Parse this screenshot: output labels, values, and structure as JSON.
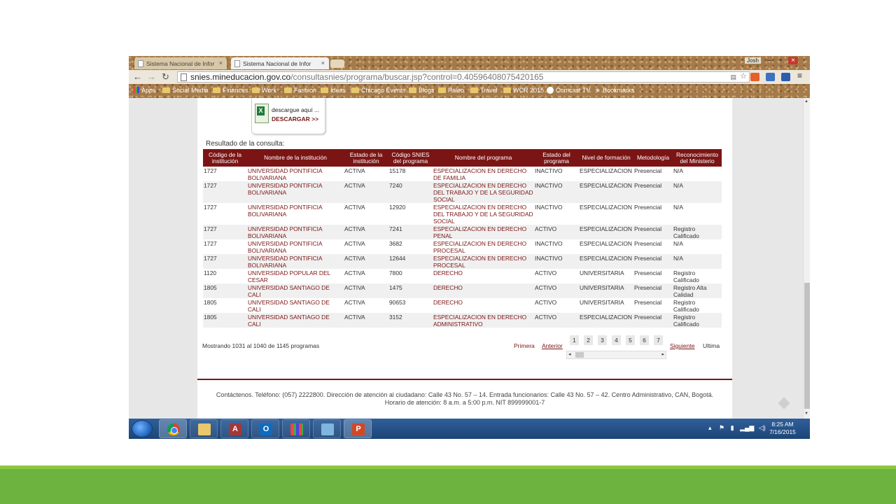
{
  "browser": {
    "tabs": [
      {
        "label": "Sistema Nacional de Infor"
      },
      {
        "label": "Sistema Nacional de Infor"
      }
    ],
    "user": "Josh",
    "url_host": "snies.mineducacion.gov.co",
    "url_path": "/consultasnies/programa/buscar.jsp?control=0.40596408075420165",
    "bookmarks": [
      "Apps",
      "Social Media",
      "Finances",
      "Work",
      "Fashion",
      "Ideas",
      "Chicago Events",
      "Blogs",
      "Paleo",
      "Travel",
      "WCR 2015",
      "Comcast TV",
      "Bookmarks"
    ]
  },
  "download": {
    "text": "descargue aquí ...",
    "link": "DESCARGAR >>"
  },
  "results": {
    "label": "Resultado de la consulta:",
    "headers": [
      "Código de la institución",
      "Nombre de la institución",
      "Estado de la institución",
      "Código SNIES del programa",
      "Nombre del programa",
      "Estado del programa",
      "Nivel de formación",
      "Metodología",
      "Reconocimiento del Ministerio"
    ],
    "rows": [
      [
        "1727",
        "UNIVERSIDAD PONTIFICIA BOLIVARIANA",
        "ACTIVA",
        "15178",
        "ESPECIALIZACION EN DERECHO DE FAMILIA",
        "INACTIVO",
        "ESPECIALIZACION",
        "Presencial",
        "N/A"
      ],
      [
        "1727",
        "UNIVERSIDAD PONTIFICIA BOLIVARIANA",
        "ACTIVA",
        "7240",
        "ESPECIALIZACION EN DERECHO DEL TRABAJO Y DE LA SEGURIDAD SOCIAL",
        "INACTIVO",
        "ESPECIALIZACION",
        "Presencial",
        "N/A"
      ],
      [
        "1727",
        "UNIVERSIDAD PONTIFICIA BOLIVARIANA",
        "ACTIVA",
        "12920",
        "ESPECIALIZACION EN DERECHO DEL TRABAJO Y DE LA SEGURIDAD SOCIAL",
        "INACTIVO",
        "ESPECIALIZACION",
        "Presencial",
        "N/A"
      ],
      [
        "1727",
        "UNIVERSIDAD PONTIFICIA BOLIVARIANA",
        "ACTIVA",
        "7241",
        "ESPECIALIZACION EN DERECHO PENAL",
        "ACTIVO",
        "ESPECIALIZACION",
        "Presencial",
        "Registro Calificado"
      ],
      [
        "1727",
        "UNIVERSIDAD PONTIFICIA BOLIVARIANA",
        "ACTIVA",
        "3682",
        "ESPECIALIZACION EN DERECHO PROCESAL",
        "INACTIVO",
        "ESPECIALIZACION",
        "Presencial",
        "N/A"
      ],
      [
        "1727",
        "UNIVERSIDAD PONTIFICIA BOLIVARIANA",
        "ACTIVA",
        "12644",
        "ESPECIALIZACION EN DERECHO PROCESAL",
        "INACTIVO",
        "ESPECIALIZACION",
        "Presencial",
        "N/A"
      ],
      [
        "1120",
        "UNIVERSIDAD POPULAR DEL CESAR",
        "ACTIVA",
        "7800",
        "DERECHO",
        "ACTIVO",
        "UNIVERSITARIA",
        "Presencial",
        "Registro Calificado"
      ],
      [
        "1805",
        "UNIVERSIDAD SANTIAGO DE CALI",
        "ACTIVA",
        "1475",
        "DERECHO",
        "ACTIVO",
        "UNIVERSITARIA",
        "Presencial",
        "Registro Alta Calidad"
      ],
      [
        "1805",
        "UNIVERSIDAD SANTIAGO DE CALI",
        "ACTIVA",
        "90653",
        "DERECHO",
        "ACTIVO",
        "UNIVERSITARIA",
        "Presencial",
        "Registro Calificado"
      ],
      [
        "1805",
        "UNIVERSIDAD SANTIAGO DE CALI",
        "ACTIVA",
        "3152",
        "ESPECIALIZACION EN DERECHO ADMINISTRATIVO",
        "ACTIVO",
        "ESPECIALIZACION",
        "Presencial",
        "Registro Calificado"
      ]
    ]
  },
  "pagination": {
    "showing": "Mostrando 1031 al 1040 de 1145 programas",
    "first": "Primera",
    "prev": "Anterior",
    "pages": [
      "1",
      "2",
      "3",
      "4",
      "5",
      "6",
      "7"
    ],
    "next": "Siguiente",
    "last": "Ultima"
  },
  "footer": {
    "line1": "Contáctenos. Teléfono: (057) 2222800. Dirección de atención al ciudadano: Calle 43 No. 57 – 14. Entrada funcionarios: Calle 43 No. 57 – 42. Centro Administrativo, CAN, Bogotá.",
    "line2": "Horario de atención: 8 a.m. a 5:00 p.m. NIT 899999001-7"
  },
  "taskbar": {
    "time": "8:25 AM",
    "date": "7/16/2015"
  },
  "colors": {
    "header_bg": "#7b1515",
    "link": "#7b1515",
    "slide_band": "#6cb33f"
  }
}
